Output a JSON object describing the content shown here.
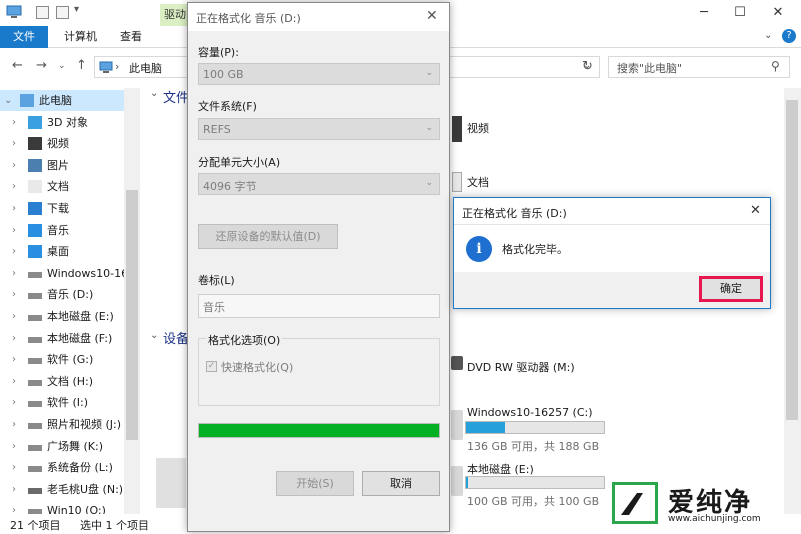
{
  "explorer": {
    "ribbon_tabs": [
      "文件",
      "计算机",
      "查看"
    ],
    "drive_tools_tab": "驱动",
    "address": "此电脑",
    "search_placeholder": "搜索\"此电脑\"",
    "nav_items": [
      {
        "label": "此电脑",
        "icon": "computer-icon"
      },
      {
        "label": "3D 对象",
        "icon": "cube-icon"
      },
      {
        "label": "视频",
        "icon": "video-icon"
      },
      {
        "label": "图片",
        "icon": "picture-icon"
      },
      {
        "label": "文档",
        "icon": "document-icon"
      },
      {
        "label": "下载",
        "icon": "download-icon"
      },
      {
        "label": "音乐",
        "icon": "music-icon"
      },
      {
        "label": "桌面",
        "icon": "desktop-icon"
      },
      {
        "label": "Windows10-16",
        "icon": "drive-icon"
      },
      {
        "label": "音乐 (D:)",
        "icon": "drive-icon"
      },
      {
        "label": "本地磁盘 (E:)",
        "icon": "drive-icon"
      },
      {
        "label": "本地磁盘 (F:)",
        "icon": "drive-icon"
      },
      {
        "label": "软件 (G:)",
        "icon": "drive-icon"
      },
      {
        "label": "文档 (H:)",
        "icon": "drive-icon"
      },
      {
        "label": "软件 (I:)",
        "icon": "drive-icon"
      },
      {
        "label": "照片和视频 (J:)",
        "icon": "drive-icon"
      },
      {
        "label": "广场舞 (K:)",
        "icon": "drive-icon"
      },
      {
        "label": "系统备份 (L:)",
        "icon": "drive-icon"
      },
      {
        "label": "老毛桃U盘 (N:)",
        "icon": "usb-drive-icon"
      },
      {
        "label": "Win10 (O:)",
        "icon": "drive-icon"
      }
    ],
    "group_folders": "文件",
    "group_devices": "设备",
    "folder_video": "视频",
    "folder_docs": "文档",
    "dvd_label": "DVD RW 驱动器 (M:)",
    "drive_c": {
      "name": "Windows10-16257 (C:)",
      "free_text": "136 GB 可用，共 188 GB",
      "used_fraction": 0.28
    },
    "drive_e": {
      "name": "本地磁盘 (E:)",
      "free_text": "100 GB 可用，共 100 GB",
      "used_fraction": 0.01
    },
    "status_items": "21 个项目",
    "status_selected": "选中 1 个项目"
  },
  "format_dialog": {
    "title": "正在格式化 音乐 (D:)",
    "capacity_label": "容量(P):",
    "capacity_value": "100 GB",
    "fs_label": "文件系统(F)",
    "fs_value": "REFS",
    "alloc_label": "分配单元大小(A)",
    "alloc_value": "4096 字节",
    "restore_defaults": "还原设备的默认值(D)",
    "volume_label": "卷标(L)",
    "volume_value": "音乐",
    "options_label": "格式化选项(O)",
    "quick_format": "快速格式化(Q)",
    "progress_fraction": 1.0,
    "start_button": "开始(S)",
    "cancel_button": "取消"
  },
  "message_box": {
    "title": "正在格式化 音乐 (D:)",
    "message": "格式化完毕。",
    "ok_button": "确定"
  },
  "watermark": {
    "text": "爱纯净",
    "url": "www.aichunjing.com"
  },
  "colors": {
    "accent": "#1979ca",
    "progress": "#06b025",
    "highlight": "#e8164f"
  }
}
